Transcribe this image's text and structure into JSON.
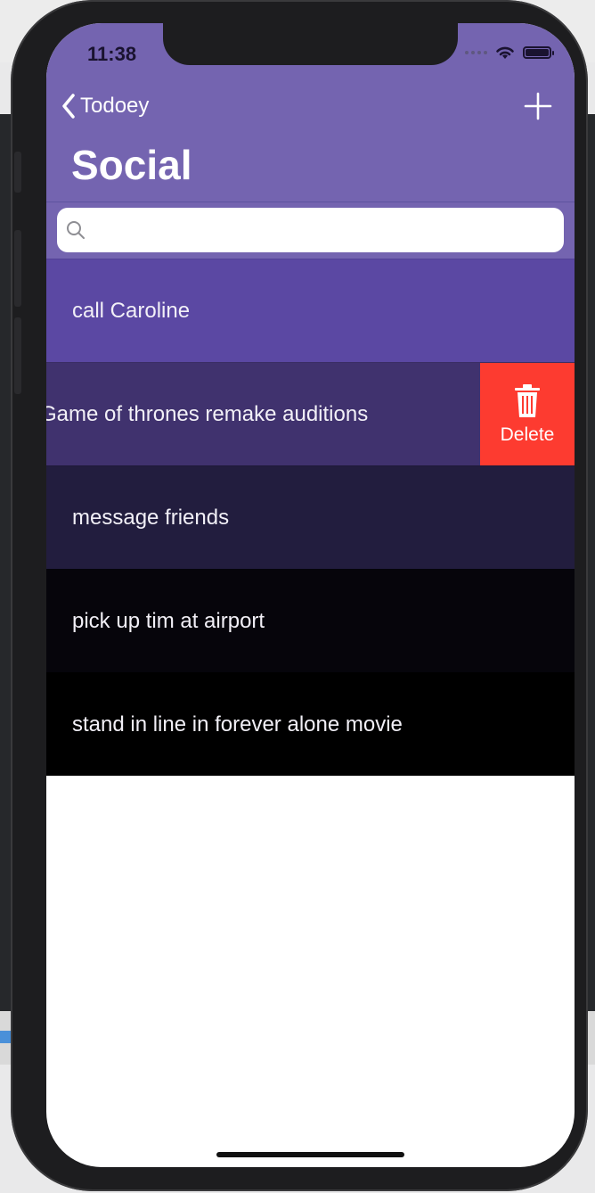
{
  "status_bar": {
    "time": "11:38"
  },
  "nav": {
    "back_label": "Todoey",
    "title": "Social",
    "add_icon": "plus-icon",
    "back_icon": "chevron-left-icon"
  },
  "search": {
    "placeholder": "",
    "value": ""
  },
  "items": [
    {
      "label": "call Caroline",
      "bg": "#5b48a3"
    },
    {
      "label": "Game of thrones remake auditions",
      "bg": "#40326e",
      "swiped": true
    },
    {
      "label": "message friends",
      "bg": "#221d3e"
    },
    {
      "label": "pick up tim at airport",
      "bg": "#06050b"
    },
    {
      "label": "stand in line in forever alone movie",
      "bg": "#000000"
    }
  ],
  "delete_action": {
    "label": "Delete",
    "icon": "trash-icon",
    "color": "#fd3b30"
  },
  "colors": {
    "nav_bg": "#7464b0"
  }
}
